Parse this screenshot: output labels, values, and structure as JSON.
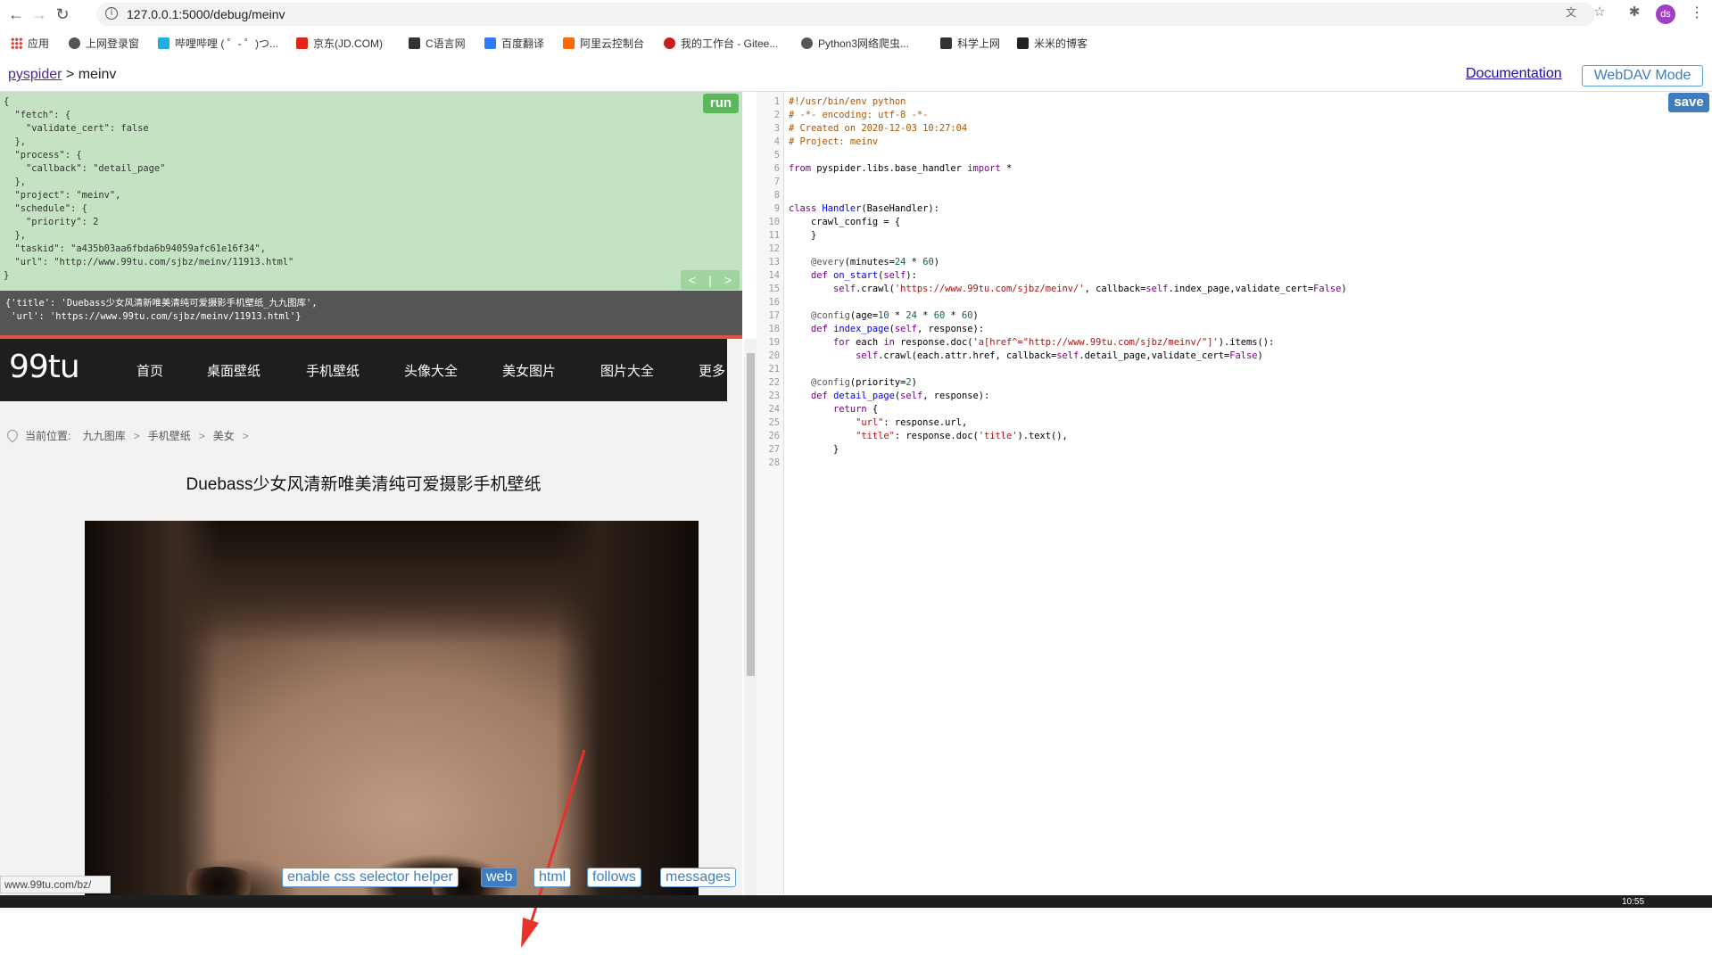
{
  "browser": {
    "url": "127.0.0.1:5000/debug/meinv",
    "avatar_initials": "ds",
    "bookmarks": [
      {
        "label": "应用",
        "icon": "apps-grid-icon",
        "color": "#e94235"
      },
      {
        "label": "上网登录窗",
        "icon": "globe-icon",
        "color": "#555555"
      },
      {
        "label": "哔哩哔哩 ( ゜- ゜)つ...",
        "icon": "bilibili-icon",
        "color": "#23ade5"
      },
      {
        "label": "京东(JD.COM)",
        "icon": "jd-icon",
        "color": "#e1251b"
      },
      {
        "label": "C语言网",
        "icon": "c-lang-icon",
        "color": "#333333"
      },
      {
        "label": "百度翻译",
        "icon": "baidu-translate-icon",
        "color": "#2d7cf6"
      },
      {
        "label": "阿里云控制台",
        "icon": "aliyun-icon",
        "color": "#ff6a00"
      },
      {
        "label": "我的工作台 - Gitee...",
        "icon": "gitee-icon",
        "color": "#c71d23"
      },
      {
        "label": "Python3网络爬虫...",
        "icon": "globe-icon",
        "color": "#555555"
      },
      {
        "label": "科学上网",
        "icon": "rocket-icon",
        "color": "#333333"
      },
      {
        "label": "米米的博客",
        "icon": "blog-icon",
        "color": "#222222"
      }
    ]
  },
  "header": {
    "project_link": "pyspider",
    "separator": " > ",
    "project_name": "meinv",
    "documentation": "Documentation",
    "webdav": "WebDAV Mode"
  },
  "task_panel": {
    "json": "{\n  \"fetch\": {\n    \"validate_cert\": false\n  },\n  \"process\": {\n    \"callback\": \"detail_page\"\n  },\n  \"project\": \"meinv\",\n  \"schedule\": {\n    \"priority\": 2\n  },\n  \"taskid\": \"a435b03aa6fbda6b94059afc61e16f34\",\n  \"url\": \"http://www.99tu.com/sjbz/meinv/11913.html\"\n}",
    "run_label": "run",
    "prev_label": "<",
    "sep_label": "|",
    "next_label": ">"
  },
  "result": {
    "text": "{'title': 'Duebass少女风清新唯美清纯可爱摄影手机壁纸_九九图库',\n 'url': 'https://www.99tu.com/sjbz/meinv/11913.html'}"
  },
  "site": {
    "logo": "99tu",
    "nav": [
      "首页",
      "桌面壁纸",
      "手机壁纸",
      "头像大全",
      "美女图片",
      "图片大全",
      "更多"
    ],
    "location_label": "当前位置:",
    "breadcrumb": [
      "九九图库",
      "手机壁纸",
      "美女"
    ],
    "breadcrumb_sep": ">",
    "heading": "Duebass少女风清新唯美清纯可爱摄影手机壁纸"
  },
  "bottom_tabs": {
    "css_helper": "enable css selector helper",
    "web": "web",
    "html": "html",
    "follows": "follows",
    "messages": "messages",
    "active": "web"
  },
  "status_bar": {
    "url": "www.99tu.com/bz/"
  },
  "editor": {
    "save_label": "save",
    "line_count": 28
  },
  "taskbar": {
    "clock": "10:55"
  }
}
